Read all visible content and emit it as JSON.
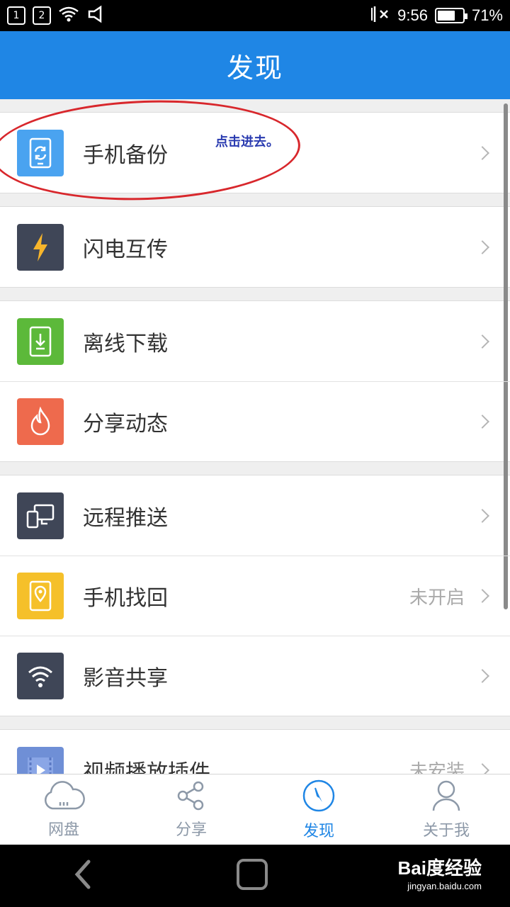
{
  "status_bar": {
    "sim1": "1",
    "sim2": "2",
    "time": "9:56",
    "battery_percent": "71%",
    "battery_level": 0.71
  },
  "header": {
    "title": "发现"
  },
  "annotation": {
    "text": "点击进去。"
  },
  "groups": [
    {
      "items": [
        {
          "label": "手机备份",
          "status": "",
          "icon": "phone-backup-icon",
          "color": "#4aa3f0"
        }
      ]
    },
    {
      "items": [
        {
          "label": "闪电互传",
          "status": "",
          "icon": "lightning-icon",
          "color": "#3f4657"
        }
      ]
    },
    {
      "items": [
        {
          "label": "离线下载",
          "status": "",
          "icon": "offline-download-icon",
          "color": "#5cb93a"
        },
        {
          "label": "分享动态",
          "status": "",
          "icon": "flame-icon",
          "color": "#ee6a4d"
        }
      ]
    },
    {
      "items": [
        {
          "label": "远程推送",
          "status": "",
          "icon": "remote-push-icon",
          "color": "#3f4657"
        },
        {
          "label": "手机找回",
          "status": "未开启",
          "icon": "phone-locate-icon",
          "color": "#f5c02a"
        },
        {
          "label": "影音共享",
          "status": "",
          "icon": "wifi-share-icon",
          "color": "#3f4657"
        }
      ]
    },
    {
      "items": [
        {
          "label": "视频播放插件",
          "status": "未安装",
          "icon": "video-plugin-icon",
          "color": "#6f8fd6"
        }
      ]
    }
  ],
  "tabs": [
    {
      "label": "网盘",
      "icon": "cloud-icon"
    },
    {
      "label": "分享",
      "icon": "share-icon"
    },
    {
      "label": "发现",
      "icon": "compass-icon",
      "active": true
    },
    {
      "label": "关于我",
      "icon": "person-icon"
    }
  ],
  "watermark": {
    "brand": "Bai度经验",
    "url": "jingyan.baidu.com"
  },
  "colors": {
    "primary": "#1f86e5",
    "annotation_red": "#d8272c"
  }
}
